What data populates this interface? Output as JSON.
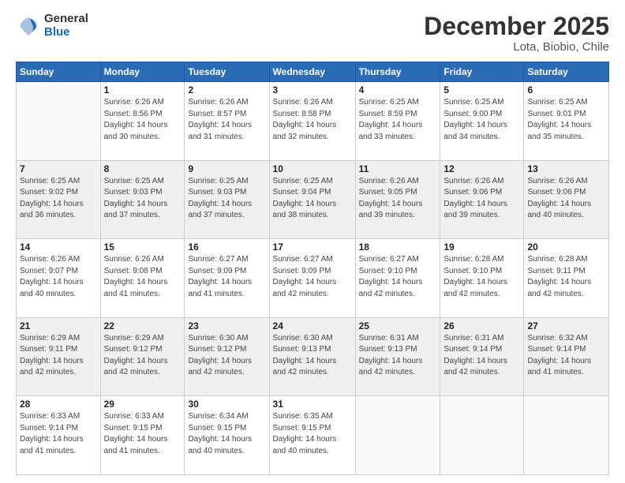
{
  "logo": {
    "general": "General",
    "blue": "Blue"
  },
  "title": "December 2025",
  "subtitle": "Lota, Biobio, Chile",
  "weekdays": [
    "Sunday",
    "Monday",
    "Tuesday",
    "Wednesday",
    "Thursday",
    "Friday",
    "Saturday"
  ],
  "weeks": [
    [
      {
        "day": "",
        "info": ""
      },
      {
        "day": "1",
        "info": "Sunrise: 6:26 AM\nSunset: 8:56 PM\nDaylight: 14 hours\nand 30 minutes."
      },
      {
        "day": "2",
        "info": "Sunrise: 6:26 AM\nSunset: 8:57 PM\nDaylight: 14 hours\nand 31 minutes."
      },
      {
        "day": "3",
        "info": "Sunrise: 6:26 AM\nSunset: 8:58 PM\nDaylight: 14 hours\nand 32 minutes."
      },
      {
        "day": "4",
        "info": "Sunrise: 6:25 AM\nSunset: 8:59 PM\nDaylight: 14 hours\nand 33 minutes."
      },
      {
        "day": "5",
        "info": "Sunrise: 6:25 AM\nSunset: 9:00 PM\nDaylight: 14 hours\nand 34 minutes."
      },
      {
        "day": "6",
        "info": "Sunrise: 6:25 AM\nSunset: 9:01 PM\nDaylight: 14 hours\nand 35 minutes."
      }
    ],
    [
      {
        "day": "7",
        "info": "Sunrise: 6:25 AM\nSunset: 9:02 PM\nDaylight: 14 hours\nand 36 minutes."
      },
      {
        "day": "8",
        "info": "Sunrise: 6:25 AM\nSunset: 9:03 PM\nDaylight: 14 hours\nand 37 minutes."
      },
      {
        "day": "9",
        "info": "Sunrise: 6:25 AM\nSunset: 9:03 PM\nDaylight: 14 hours\nand 37 minutes."
      },
      {
        "day": "10",
        "info": "Sunrise: 6:25 AM\nSunset: 9:04 PM\nDaylight: 14 hours\nand 38 minutes."
      },
      {
        "day": "11",
        "info": "Sunrise: 6:26 AM\nSunset: 9:05 PM\nDaylight: 14 hours\nand 39 minutes."
      },
      {
        "day": "12",
        "info": "Sunrise: 6:26 AM\nSunset: 9:06 PM\nDaylight: 14 hours\nand 39 minutes."
      },
      {
        "day": "13",
        "info": "Sunrise: 6:26 AM\nSunset: 9:06 PM\nDaylight: 14 hours\nand 40 minutes."
      }
    ],
    [
      {
        "day": "14",
        "info": "Sunrise: 6:26 AM\nSunset: 9:07 PM\nDaylight: 14 hours\nand 40 minutes."
      },
      {
        "day": "15",
        "info": "Sunrise: 6:26 AM\nSunset: 9:08 PM\nDaylight: 14 hours\nand 41 minutes."
      },
      {
        "day": "16",
        "info": "Sunrise: 6:27 AM\nSunset: 9:09 PM\nDaylight: 14 hours\nand 41 minutes."
      },
      {
        "day": "17",
        "info": "Sunrise: 6:27 AM\nSunset: 9:09 PM\nDaylight: 14 hours\nand 42 minutes."
      },
      {
        "day": "18",
        "info": "Sunrise: 6:27 AM\nSunset: 9:10 PM\nDaylight: 14 hours\nand 42 minutes."
      },
      {
        "day": "19",
        "info": "Sunrise: 6:28 AM\nSunset: 9:10 PM\nDaylight: 14 hours\nand 42 minutes."
      },
      {
        "day": "20",
        "info": "Sunrise: 6:28 AM\nSunset: 9:11 PM\nDaylight: 14 hours\nand 42 minutes."
      }
    ],
    [
      {
        "day": "21",
        "info": "Sunrise: 6:29 AM\nSunset: 9:11 PM\nDaylight: 14 hours\nand 42 minutes."
      },
      {
        "day": "22",
        "info": "Sunrise: 6:29 AM\nSunset: 9:12 PM\nDaylight: 14 hours\nand 42 minutes."
      },
      {
        "day": "23",
        "info": "Sunrise: 6:30 AM\nSunset: 9:12 PM\nDaylight: 14 hours\nand 42 minutes."
      },
      {
        "day": "24",
        "info": "Sunrise: 6:30 AM\nSunset: 9:13 PM\nDaylight: 14 hours\nand 42 minutes."
      },
      {
        "day": "25",
        "info": "Sunrise: 6:31 AM\nSunset: 9:13 PM\nDaylight: 14 hours\nand 42 minutes."
      },
      {
        "day": "26",
        "info": "Sunrise: 6:31 AM\nSunset: 9:14 PM\nDaylight: 14 hours\nand 42 minutes."
      },
      {
        "day": "27",
        "info": "Sunrise: 6:32 AM\nSunset: 9:14 PM\nDaylight: 14 hours\nand 41 minutes."
      }
    ],
    [
      {
        "day": "28",
        "info": "Sunrise: 6:33 AM\nSunset: 9:14 PM\nDaylight: 14 hours\nand 41 minutes."
      },
      {
        "day": "29",
        "info": "Sunrise: 6:33 AM\nSunset: 9:15 PM\nDaylight: 14 hours\nand 41 minutes."
      },
      {
        "day": "30",
        "info": "Sunrise: 6:34 AM\nSunset: 9:15 PM\nDaylight: 14 hours\nand 40 minutes."
      },
      {
        "day": "31",
        "info": "Sunrise: 6:35 AM\nSunset: 9:15 PM\nDaylight: 14 hours\nand 40 minutes."
      },
      {
        "day": "",
        "info": ""
      },
      {
        "day": "",
        "info": ""
      },
      {
        "day": "",
        "info": ""
      }
    ]
  ]
}
